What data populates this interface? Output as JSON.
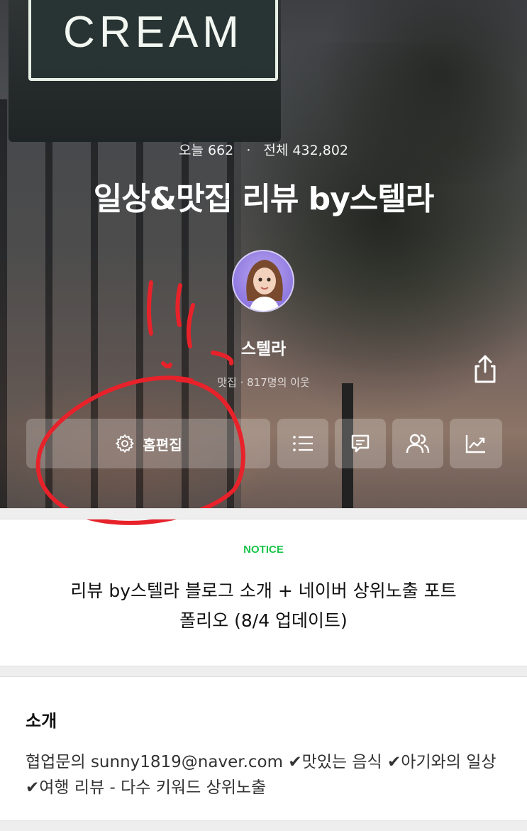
{
  "hero": {
    "sign_text": "CREAM",
    "stats": {
      "today_label": "오늘",
      "today_value": "662",
      "separator": "·",
      "total_label": "전체",
      "total_value": "432,802"
    },
    "blog_title": "일상&맛집 리뷰 by스텔라",
    "nickname": "스텔라",
    "meta": "맛집 · 817명의 이웃"
  },
  "actions": {
    "edit_label": "홈편집",
    "icons": [
      "gear-icon",
      "list-icon",
      "chat-icon",
      "friends-icon",
      "stats-icon",
      "share-icon"
    ]
  },
  "notice": {
    "label": "NOTICE",
    "title": "리뷰 by스텔라 블로그 소개 + 네이버 상위노출 포트폴리오 (8/4 업데이트)"
  },
  "intro": {
    "heading": "소개",
    "body": "협업문의 sunny1819@naver.com ✔맛있는 음식 ✔아기와의 일상 ✔여행 리뷰 -  다수 키워드 상위노출"
  },
  "colors": {
    "notice_accent": "#19c44a",
    "annotation": "#e8222a"
  }
}
